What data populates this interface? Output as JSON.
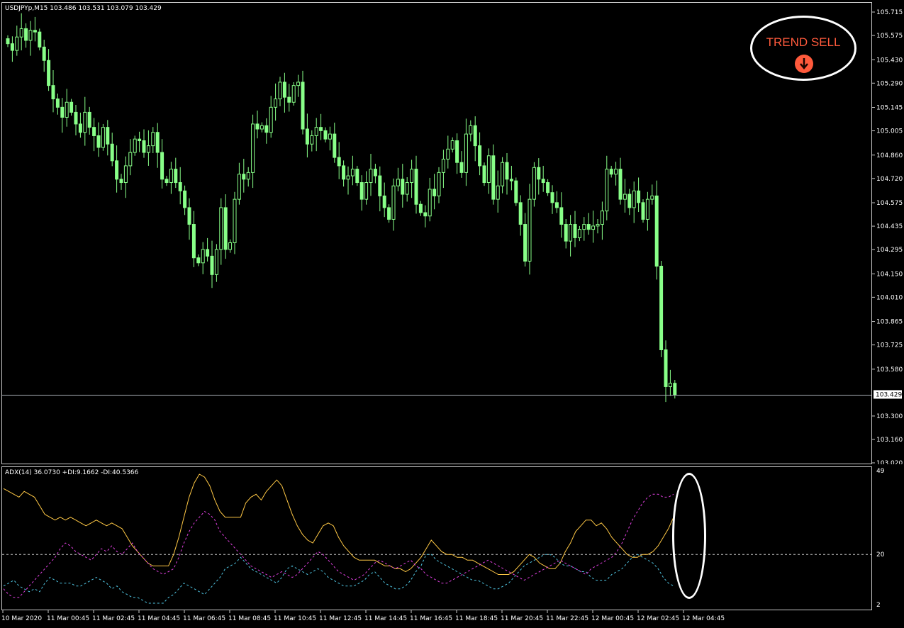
{
  "header": {
    "symbol_info": "USDJPYp,M15  103.486 103.531 103.079 103.429",
    "indicator_info": "ADX(14) 36.0730 +DI:9.1662 -DI:40.5366"
  },
  "badge": {
    "text": "TREND SELL",
    "icon": "down-arrow-circle-icon",
    "text_color": "#ff5a3c",
    "border_color": "#ffffff"
  },
  "price_axis": {
    "labels": [
      "105.715",
      "105.575",
      "105.430",
      "105.290",
      "105.145",
      "105.005",
      "104.860",
      "104.720",
      "104.575",
      "104.435",
      "104.295",
      "104.150",
      "104.010",
      "103.865",
      "103.725",
      "103.580",
      "103.300",
      "103.160",
      "103.020"
    ],
    "current_price": "103.429"
  },
  "indicator_axis": {
    "labels": [
      "49",
      "20",
      "2"
    ],
    "level_line": 20
  },
  "time_axis": {
    "labels": [
      "10 Mar 2020",
      "11 Mar 00:45",
      "11 Mar 02:45",
      "11 Mar 04:45",
      "11 Mar 06:45",
      "11 Mar 08:45",
      "11 Mar 10:45",
      "11 Mar 12:45",
      "11 Mar 14:45",
      "11 Mar 16:45",
      "11 Mar 18:45",
      "11 Mar 20:45",
      "11 Mar 22:45",
      "12 Mar 00:45",
      "12 Mar 02:45",
      "12 Mar 04:45"
    ]
  },
  "colors": {
    "candle": "#88ff88",
    "adx": "#ffc845",
    "plus_di": "#4fc3e0",
    "minus_di": "#e040e0",
    "grid": "#c8c8c8",
    "current_price_line": "#aab0b8"
  },
  "chart_data": [
    {
      "type": "candlestick",
      "title": "USDJPYp,M15",
      "ylim": [
        103.02,
        105.715
      ],
      "closes": [
        105.53,
        105.49,
        105.57,
        105.62,
        105.55,
        105.61,
        105.6,
        105.51,
        105.43,
        105.28,
        105.2,
        105.15,
        105.09,
        105.18,
        105.12,
        105.05,
        105.0,
        105.12,
        105.03,
        104.98,
        104.91,
        105.03,
        104.93,
        104.83,
        104.72,
        104.7,
        104.8,
        104.88,
        104.96,
        104.95,
        104.88,
        104.92,
        105.0,
        104.88,
        104.72,
        104.7,
        104.78,
        104.7,
        104.65,
        104.55,
        104.45,
        104.25,
        104.22,
        104.3,
        104.26,
        104.15,
        104.3,
        104.55,
        104.3,
        104.34,
        104.6,
        104.75,
        104.72,
        104.76,
        105.05,
        105.02,
        105.04,
        105.0,
        105.15,
        105.2,
        105.3,
        105.21,
        105.18,
        105.28,
        105.3,
        105.02,
        104.93,
        104.98,
        105.03,
        105.01,
        104.96,
        104.99,
        104.85,
        104.8,
        104.72,
        104.74,
        104.78,
        104.7,
        104.6,
        104.7,
        104.78,
        104.74,
        104.62,
        104.55,
        104.48,
        104.68,
        104.72,
        104.63,
        104.7,
        104.78,
        104.57,
        104.52,
        104.5,
        104.66,
        104.62,
        104.76,
        104.84,
        104.9,
        104.95,
        104.82,
        104.76,
        104.99,
        105.04,
        104.92,
        104.8,
        104.7,
        104.86,
        104.6,
        104.68,
        104.82,
        104.72,
        104.71,
        104.58,
        104.45,
        104.23,
        104.6,
        104.79,
        104.72,
        104.7,
        104.64,
        104.58,
        104.55,
        104.45,
        104.35,
        104.45,
        104.37,
        104.42,
        104.45,
        104.42,
        104.44,
        104.45,
        104.53,
        104.78,
        104.75,
        104.78,
        104.6,
        104.63,
        104.55,
        104.65,
        104.58,
        104.48,
        104.6,
        104.62,
        104.2,
        103.7,
        103.48,
        103.5,
        103.429
      ]
    },
    {
      "type": "line",
      "title": "ADX(14)",
      "ylim": [
        2,
        49
      ],
      "level": 20,
      "series": [
        {
          "name": "ADX",
          "values": [
            43,
            42,
            41,
            40,
            42,
            41,
            40,
            37,
            34,
            33,
            32,
            33,
            32,
            33,
            32,
            31,
            30,
            31,
            32,
            31,
            30,
            31,
            30,
            29,
            26,
            23,
            21,
            19,
            17,
            16,
            16,
            16,
            16,
            20,
            26,
            33,
            40,
            45,
            48,
            47,
            44,
            39,
            35,
            33,
            33,
            33,
            33,
            38,
            40,
            41,
            39,
            42,
            44,
            46,
            44,
            39,
            34,
            30,
            27,
            25,
            24,
            27,
            30,
            31,
            30,
            26,
            23,
            21,
            19,
            18,
            18,
            18,
            18,
            17,
            16,
            16,
            15,
            15,
            14,
            15,
            17,
            19,
            22,
            25,
            23,
            21,
            20,
            20,
            19,
            19,
            18,
            18,
            17,
            16,
            15,
            14,
            13,
            13,
            13,
            14,
            16,
            18,
            20,
            19,
            17,
            16,
            15,
            15,
            17,
            21,
            24,
            28,
            30,
            32,
            32,
            30,
            31,
            29,
            26,
            24,
            22,
            20,
            19,
            19,
            20,
            20,
            21,
            23,
            26,
            29,
            33
          ]
        },
        {
          "name": "+DI",
          "values": [
            9,
            10,
            11,
            9,
            8,
            7,
            8,
            7,
            10,
            12,
            11,
            10,
            10,
            10,
            9,
            9,
            10,
            11,
            12,
            11,
            10,
            8,
            9,
            7,
            6,
            5,
            5,
            4,
            3,
            3,
            3,
            3,
            5,
            6,
            8,
            10,
            9,
            8,
            7,
            6,
            8,
            10,
            12,
            15,
            16,
            17,
            19,
            17,
            15,
            14,
            13,
            12,
            11,
            10,
            12,
            15,
            16,
            15,
            14,
            13,
            14,
            15,
            14,
            12,
            11,
            10,
            9,
            9,
            9,
            10,
            11,
            13,
            14,
            12,
            10,
            9,
            8,
            8,
            9,
            11,
            14,
            16,
            20,
            20,
            18,
            17,
            16,
            15,
            14,
            13,
            12,
            11,
            11,
            10,
            9,
            8,
            8,
            9,
            10,
            12,
            14,
            16,
            17,
            18,
            19,
            20,
            20,
            19,
            17,
            16,
            16,
            15,
            14,
            14,
            12,
            11,
            11,
            11,
            13,
            14,
            15,
            17,
            19,
            20,
            19,
            18,
            17,
            15,
            12,
            10,
            9
          ]
        },
        {
          "name": "-DI",
          "values": [
            8,
            6,
            5,
            5,
            7,
            9,
            11,
            13,
            15,
            17,
            19,
            22,
            24,
            23,
            21,
            20,
            19,
            18,
            20,
            22,
            21,
            23,
            21,
            20,
            22,
            24,
            21,
            19,
            17,
            15,
            14,
            13,
            14,
            15,
            19,
            24,
            28,
            31,
            33,
            35,
            34,
            32,
            28,
            26,
            24,
            22,
            20,
            18,
            16,
            15,
            14,
            13,
            12,
            13,
            14,
            13,
            12,
            13,
            15,
            17,
            19,
            21,
            20,
            18,
            16,
            14,
            13,
            12,
            11,
            12,
            13,
            15,
            17,
            18,
            17,
            16,
            15,
            16,
            17,
            18,
            16,
            15,
            13,
            12,
            11,
            10,
            10,
            11,
            12,
            13,
            14,
            15,
            16,
            17,
            18,
            17,
            16,
            15,
            14,
            13,
            12,
            11,
            12,
            13,
            14,
            15,
            16,
            17,
            18,
            17,
            16,
            15,
            14,
            13,
            15,
            16,
            17,
            18,
            19,
            21,
            24,
            28,
            32,
            35,
            38,
            40,
            41,
            41,
            40,
            40,
            41
          ]
        }
      ]
    }
  ]
}
